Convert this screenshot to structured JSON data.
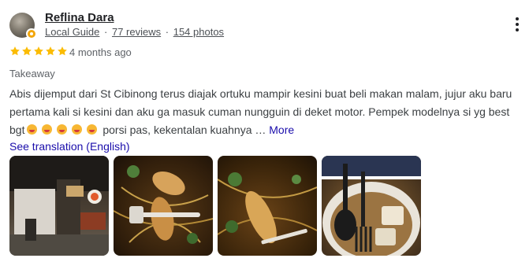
{
  "reviewer": {
    "name": "Reflina Dara",
    "badge": "Local Guide",
    "reviews": "77 reviews",
    "photos": "154 photos",
    "separator": "·"
  },
  "review": {
    "rating": 5,
    "max_rating": 5,
    "age": "4 months ago",
    "service_type": "Takeaway",
    "text_part1": "Abis dijemput dari St Cibinong terus diajak ortuku mampir kesini buat beli makan malam, jujur aku baru pertama kali si kesini dan aku ga masuk cuman nungguin di deket motor. Pempek modelnya si yg best bgt",
    "text_part2": " porsi pas, kekentalan kuahnya ",
    "ellipsis": "…",
    "more_label": "More",
    "translate_label": "See translation (English)"
  },
  "colors": {
    "star": "#fbbc04",
    "link": "#1a0dab",
    "text": "#3c4043",
    "meta": "#5f6368"
  },
  "icons": {
    "menu": "more-vert-icon",
    "star": "star-icon",
    "emoji": "grinning-squinting-face-emoji"
  }
}
